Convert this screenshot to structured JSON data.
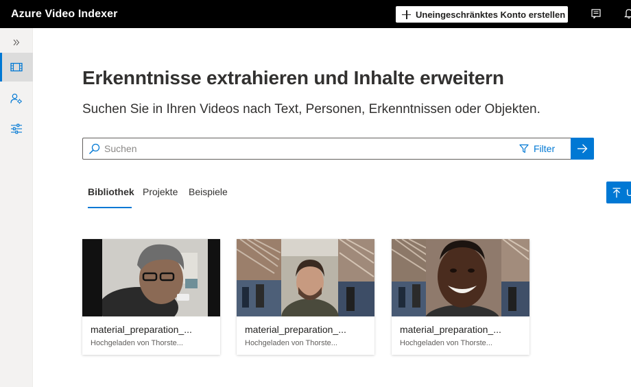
{
  "header": {
    "app_title": "Azure Video Indexer",
    "create_account_label": "Uneingeschränktes Konto erstellen",
    "icons": [
      "feedback-icon",
      "bell-icon"
    ]
  },
  "sidebar": {
    "items": [
      {
        "name": "expand",
        "icon": "chevron-double-right-icon"
      },
      {
        "name": "media-library",
        "icon": "film-icon",
        "active": true
      },
      {
        "name": "people-settings",
        "icon": "person-settings-icon"
      },
      {
        "name": "model-customization",
        "icon": "sliders-icon"
      }
    ]
  },
  "main": {
    "title": "Erkenntnisse extrahieren und Inhalte erweitern",
    "subtitle": "Suchen Sie in Ihren Videos nach Text, Personen, Erkenntnissen oder Objekten.",
    "search": {
      "placeholder": "Suchen",
      "value": "",
      "filter_label": "Filter"
    },
    "tabs": [
      {
        "label": "Bibliothek",
        "active": true
      },
      {
        "label": "Projekte",
        "active": false
      },
      {
        "label": "Beispiele",
        "active": false
      }
    ],
    "upload_label": "U",
    "videos": [
      {
        "title": "material_preparation_...",
        "uploaded_by": "Hochgeladen von Thorste..."
      },
      {
        "title": "material_preparation_...",
        "uploaded_by": "Hochgeladen von Thorste..."
      },
      {
        "title": "material_preparation_...",
        "uploaded_by": "Hochgeladen von Thorste..."
      }
    ]
  },
  "colors": {
    "accent": "#0078d4",
    "topbar": "#000000",
    "sidebar": "#f3f2f1",
    "text": "#323130"
  }
}
